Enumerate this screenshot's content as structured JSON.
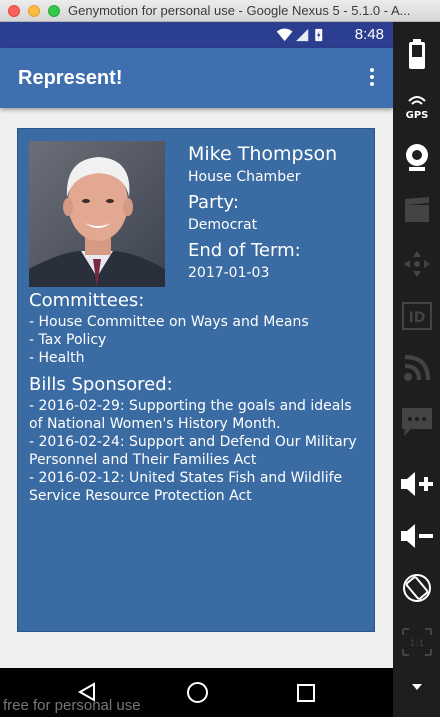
{
  "window": {
    "title": "Genymotion for personal use - Google Nexus 5 - 5.1.0 - A..."
  },
  "status_bar": {
    "time": "8:48",
    "battery_level": "charging"
  },
  "app_bar": {
    "title": "Represent!",
    "menu_icon": "more-vert-icon"
  },
  "representative": {
    "name": "Mike Thompson",
    "chamber": "House Chamber",
    "party_label": "Party:",
    "party": "Democrat",
    "term_label": "End of Term:",
    "term_end": "2017-01-03"
  },
  "committees": {
    "heading": "Committees:",
    "items": [
      "- House Committee on Ways and Means",
      "- Tax Policy",
      "- Health"
    ]
  },
  "bills": {
    "heading": "Bills Sponsored:",
    "items": [
      "- 2016-02-29: Supporting the goals and ideals of National Women's History Month.",
      "- 2016-02-24: Support and Defend Our Military Personnel and Their Families Act",
      "- 2016-02-12: United States Fish and Wildlife Service Resource Protection Act"
    ]
  },
  "watermark": "free for personal use",
  "colors": {
    "status_bar": "#2c3e8f",
    "app_bar": "#3f6fae",
    "card": "#3a6ba3",
    "background": "#f0f0f0"
  },
  "sidebar_tools": [
    "battery-icon",
    "gps-icon",
    "webcam-icon",
    "video-capture-icon",
    "dpad-icon",
    "device-id-icon",
    "rss-icon",
    "sms-icon",
    "volume-up-icon",
    "volume-down-icon",
    "rotate-icon",
    "pixel-perfect-icon"
  ]
}
